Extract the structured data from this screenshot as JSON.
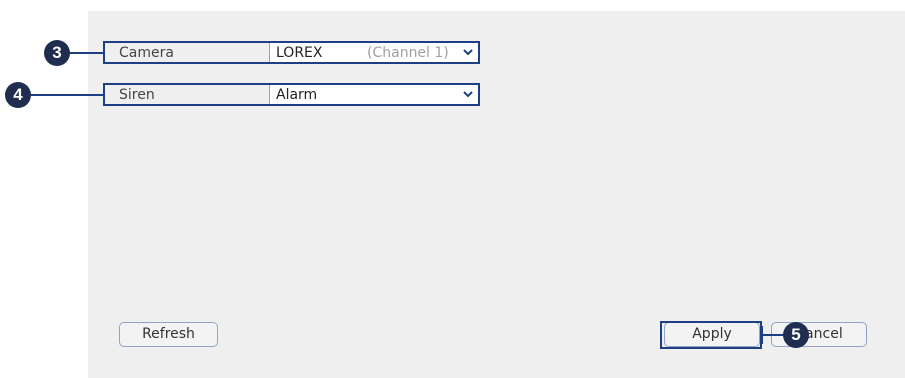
{
  "form": {
    "camera": {
      "label": "Camera",
      "value": "LOREX",
      "hint": "(Channel 1)"
    },
    "siren": {
      "label": "Siren",
      "value": "Alarm"
    }
  },
  "buttons": {
    "refresh": "Refresh",
    "apply": "Apply",
    "cancel": "Cancel"
  },
  "callouts": {
    "camera": "3",
    "siren": "4",
    "apply": "5"
  },
  "colors": {
    "panel": "#efefef",
    "highlight": "#1e3f84",
    "callout": "#1f2d4e",
    "button_border": "#8fa4c7"
  }
}
